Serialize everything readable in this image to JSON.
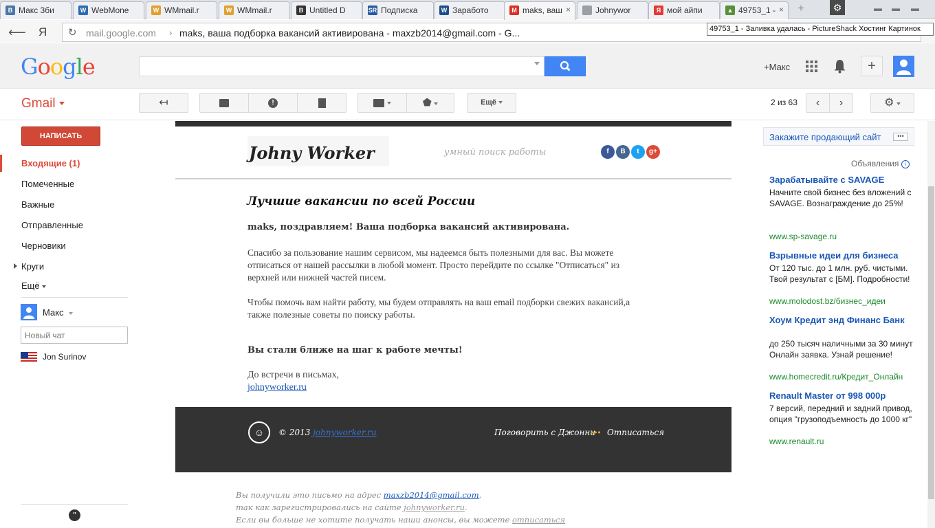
{
  "browser": {
    "tabs": [
      {
        "title": "Макс 3би",
        "favicon": "vk-icon",
        "color": "#4a76a8",
        "glyph": "В"
      },
      {
        "title": "WebMone",
        "favicon": "webmoney-icon",
        "color": "#2c6bb3",
        "glyph": "W"
      },
      {
        "title": "WMmail.r",
        "favicon": "wmmail-icon",
        "color": "#e0a030",
        "glyph": "W"
      },
      {
        "title": "WMmail.r",
        "favicon": "wmmail-icon",
        "color": "#e0a030",
        "glyph": "W"
      },
      {
        "title": "Untitled D",
        "favicon": "b-icon",
        "color": "#333333",
        "glyph": "B"
      },
      {
        "title": "Подписка",
        "favicon": "sr-icon",
        "color": "#2a5aa0",
        "glyph": "SR"
      },
      {
        "title": "Заработо",
        "favicon": "wmzona-icon",
        "color": "#1f4f8a",
        "glyph": "W"
      },
      {
        "title": "maks, ваш",
        "favicon": "gmail-icon",
        "color": "#d93025",
        "glyph": "M"
      },
      {
        "title": "Johnywor",
        "favicon": "page-icon",
        "color": "#9aa0a6",
        "glyph": ""
      },
      {
        "title": "мой айпи",
        "favicon": "yandex-icon",
        "color": "#e53935",
        "glyph": "Я"
      },
      {
        "title": "49753_1 -",
        "favicon": "pictureshack-icon",
        "color": "#5a8f3a",
        "glyph": "▲"
      }
    ],
    "tooltip": "49753_1 - Заливка удалась - PictureShack Хостинг Картинок",
    "address_host": "mail.google.com",
    "address_sep": "›",
    "address_title": "maks, ваша подборка вакансий активирована - maxzb2014@gmail.com - G...",
    "yandex_btn": "Я"
  },
  "google": {
    "logo": [
      "G",
      "o",
      "o",
      "g",
      "l",
      "e"
    ],
    "logo_colors": [
      "#4285f4",
      "#ea4335",
      "#fbbc05",
      "#4285f4",
      "#34a853",
      "#ea4335"
    ],
    "search_value": "",
    "plus_name": "+Макс"
  },
  "gmail": {
    "label": "Gmail",
    "more_label": "Ещё",
    "count": "2 из 63",
    "compose": "НАПИСАТЬ",
    "nav": [
      "Входящие (1)",
      "Помеченные",
      "Важные",
      "Отправленные",
      "Черновики",
      "Круги",
      "Ещё"
    ],
    "chat_user": "Макс",
    "chat_placeholder": "Новый чат",
    "contact": "Jon Surinov"
  },
  "email": {
    "logo": "Johny Worker",
    "tagline": "умный поиск работы",
    "social": [
      "f",
      "В",
      "t",
      "g+"
    ],
    "social_colors": [
      "#3b5998",
      "#45668e",
      "#1da1f2",
      "#dd4b39"
    ],
    "heading": "Лучшие вакансии по всей России",
    "greeting": "maks, поздравляем! Ваша подборка вакансий активирована.",
    "para1": "Спасибо за пользование нашим сервисом, мы надеемся быть полезными для вас. Вы можете отписаться от нашей рассылки в любой момент. Просто перейдите по ссылке \"Отписаться\" из верхней или нижней частей писем.",
    "para2": "Чтобы помочь вам найти работу, мы будем отправлять на ваш email подборки свежих вакансий,а также полезные советы по поиску работы.",
    "closer": "Вы стали ближе на шаг к работе мечты!",
    "signoff": "До встречи в письмах,",
    "site_link": "johnyworker.ru",
    "footer_copy": "© 2013",
    "footer_link": "johnyworker.ru",
    "footer_talk": "Поговорить с Джонни",
    "footer_unsub": "Отписаться",
    "note_1a": "Вы получили это письмо на адрес",
    "note_1_email": "maxzb2014@gmail.com",
    "note_1b": ",",
    "note_2a": "так как зарегистрировались на сайте",
    "note_2_link": "johnyworker.ru",
    "note_2b": ".",
    "note_3a": "Если вы больше не хотите получать наши анонсы, вы можете",
    "note_3_link": "отписаться"
  },
  "ads": {
    "top_link": "Закажите продающий сайт",
    "label": "Объявления",
    "items": [
      {
        "title": "Зарабатывайте с SAVAGE",
        "text": "Начните свой бизнес без вложений с SAVAGE. Вознаграждение до 25%!",
        "url": "www.sp-savage.ru"
      },
      {
        "title": "Взрывные идеи для бизнеса",
        "text": "От 120 тыс. до 1 млн. руб. чистыми. Твой результат с [БМ]. Подробности!",
        "url": "www.molodost.bz/бизнес_идеи"
      },
      {
        "title": "Хоум Кредит энд Финанс Банк",
        "text": "до 250 тысяч наличными за 30 минут Онлайн заявка. Узнай решение!",
        "url": "www.homecredit.ru/Кредит_Онлайн"
      },
      {
        "title": "Renault Master от 998 000р",
        "text": "7 версий, передний и задний привод, опция \"грузоподъемность до 1000 кг\"",
        "url": "www.renault.ru"
      }
    ]
  }
}
